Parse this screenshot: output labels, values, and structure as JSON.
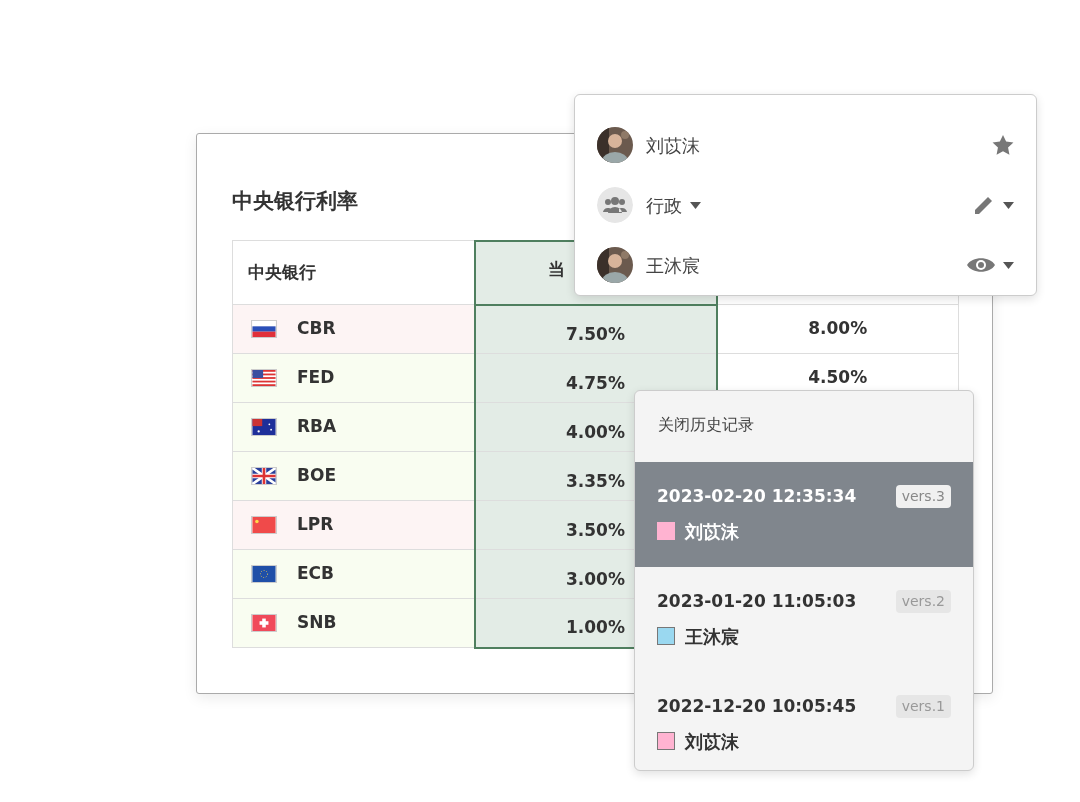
{
  "card": {
    "title": "中央银行利率",
    "table": {
      "columns": [
        "中央银行",
        "当"
      ],
      "rows": [
        {
          "kind": "russia",
          "bank": "CBR",
          "color": "#fdf4f4",
          "current": "7.50%",
          "column_3": "8.00%"
        },
        {
          "kind": "usa",
          "bank": "FED",
          "color": "#f9fdf1",
          "current": "4.75%",
          "column_3": "4.50%"
        },
        {
          "kind": "australia",
          "bank": "RBA",
          "color": "#f9fdf1",
          "current": "4.00%"
        },
        {
          "kind": "uk",
          "bank": "BOE",
          "color": "#f9fdf1",
          "current": "3.35%"
        },
        {
          "kind": "china",
          "bank": "LPR",
          "color": "#fdf4f4",
          "current": "3.50%"
        },
        {
          "kind": "eu",
          "bank": "ECB",
          "color": "#f9fdf1",
          "current": "3.00%"
        },
        {
          "kind": "switzerland",
          "bank": "SNB",
          "color": "#f9fdf1",
          "current": "1.00%"
        }
      ]
    }
  },
  "share_menu": {
    "items": [
      {
        "kind": "owner",
        "name": "刘苡沫"
      },
      {
        "kind": "group",
        "name": "行政"
      },
      {
        "kind": "viewer",
        "name": "王沐宸"
      }
    ]
  },
  "history": {
    "title": "关闭历史记录",
    "versions": [
      {
        "time": "2023-02-20 12:35:34",
        "version": "vers.3",
        "author": "刘苡沫",
        "color": "#ffb3d1",
        "selected": true
      },
      {
        "time": "2023-01-20 11:05:03",
        "version": "vers.2",
        "author": "王沐宸",
        "color": "#9ad8f0",
        "selected": false
      },
      {
        "time": "2022-12-20 10:05:45",
        "version": "vers.1",
        "author": "刘苡沫",
        "color": "#ffb3d1",
        "selected": false
      }
    ]
  }
}
